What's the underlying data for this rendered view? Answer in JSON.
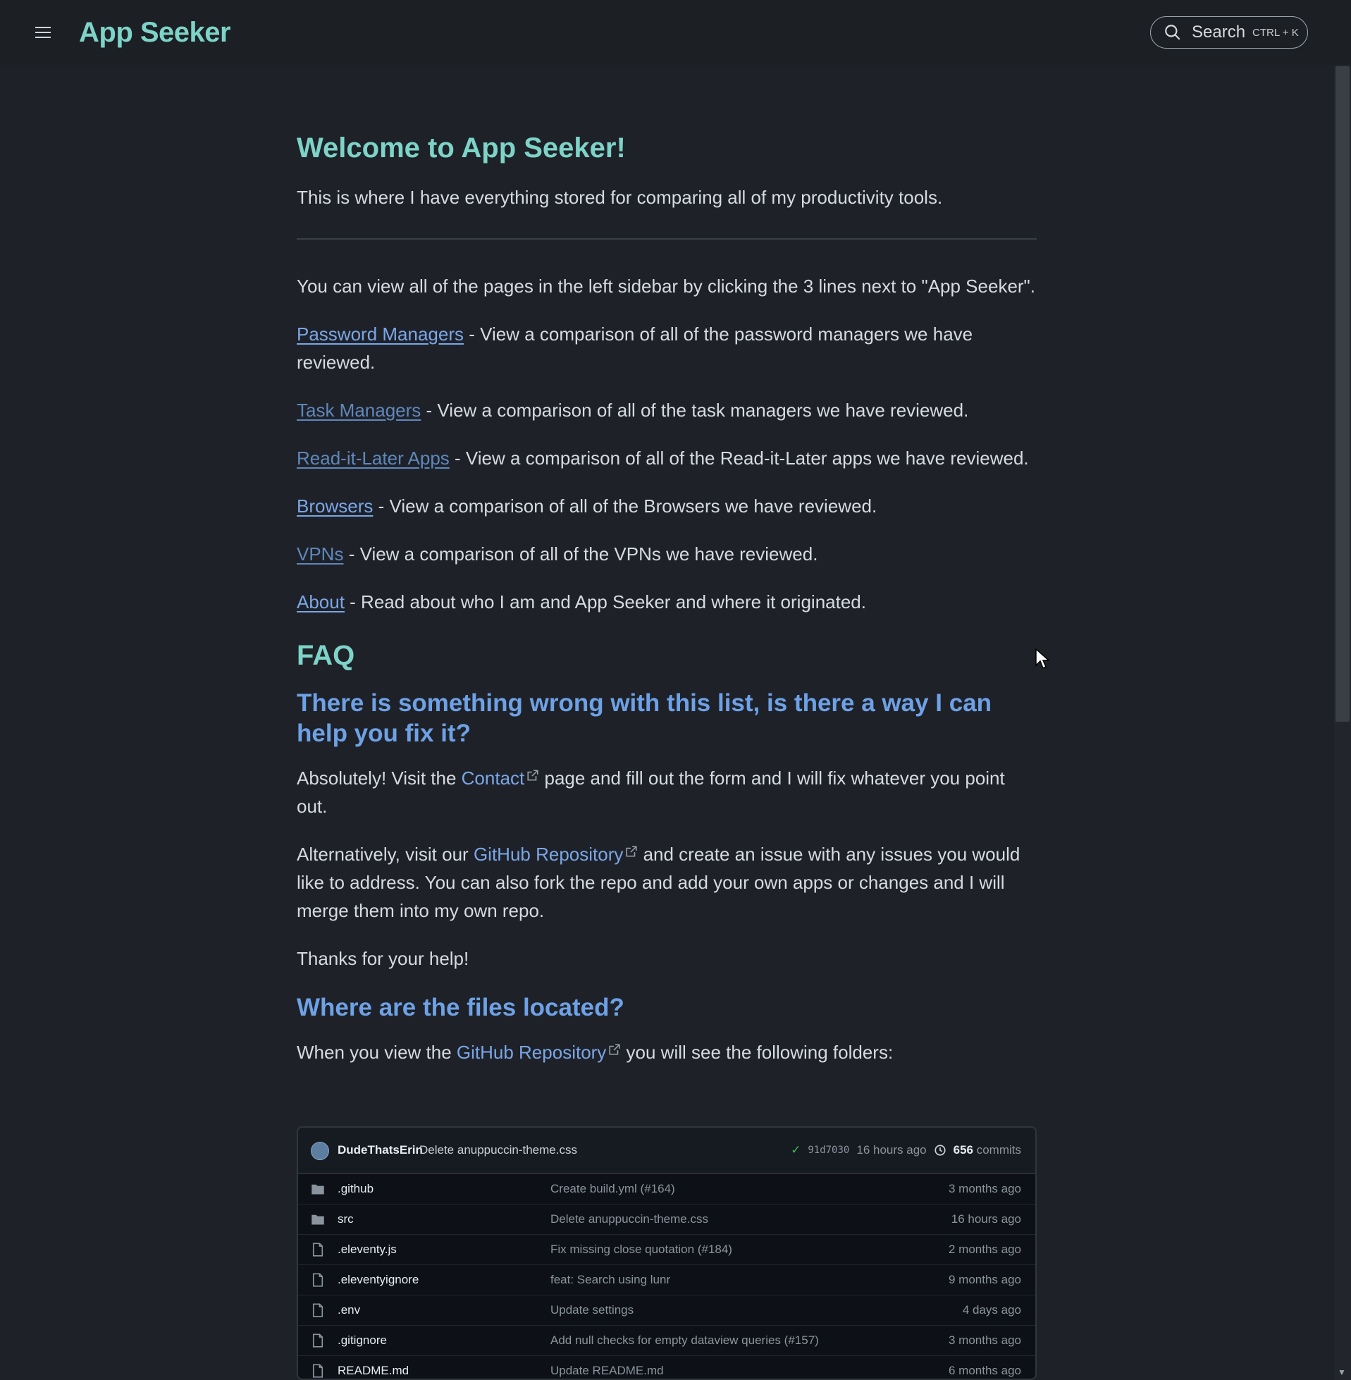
{
  "header": {
    "menu_icon": "hamburger-menu-icon",
    "site_title": "App Seeker",
    "search_label": "Search",
    "search_shortcut": "CTRL + K"
  },
  "main": {
    "title": "Welcome to App Seeker!",
    "intro": "This is where I have everything stored for comparing all of my productivity tools.",
    "sidebar_note": "You can view all of the pages in the left sidebar by clicking the 3 lines next to \"App Seeker\".",
    "links": [
      {
        "label": "Password Managers",
        "desc": " - View a comparison of all of the password managers we have reviewed."
      },
      {
        "label": "Task Managers",
        "desc": " - View a comparison of all of the task managers we have reviewed."
      },
      {
        "label": "Read-it-Later Apps",
        "desc": " - View a comparison of all of the Read-it-Later apps we have reviewed."
      },
      {
        "label": "Browsers",
        "desc": " - View a comparison of all of the Browsers we have reviewed."
      },
      {
        "label": "VPNs",
        "desc": " - View a comparison of all of the VPNs we have reviewed."
      },
      {
        "label": "About",
        "desc": " - Read about who I am and App Seeker and where it originated."
      }
    ],
    "faq_heading": "FAQ",
    "faq1": {
      "question": "There is something wrong with this list, is there a way I can help you fix it?",
      "p1_before": "Absolutely! Visit the ",
      "p1_link": "Contact",
      "p1_after": " page and fill out the form and I will fix whatever you point out.",
      "p2_before": "Alternatively, visit our ",
      "p2_link": "GitHub Repository",
      "p2_after": " and create an issue with any issues you would like to address. You can also fork the repo and add your own apps or changes and I will merge them into my own repo.",
      "p3": "Thanks for your help!"
    },
    "faq2": {
      "question": "Where are the files located?",
      "p_before": "When you view the ",
      "p_link": "GitHub Repository",
      "p_after": " you will see the following folders:"
    }
  },
  "repo": {
    "author": "DudeThatsErin",
    "commit_message": "Delete anuppuccin-theme.css",
    "commit_hash": "91d7030",
    "commit_age": "16 hours ago",
    "commit_count": "656",
    "commits_label": "commits",
    "files": [
      {
        "type": "folder",
        "name": ".github",
        "message": "Create build.yml (#164)",
        "age": "3 months ago"
      },
      {
        "type": "folder",
        "name": "src",
        "message": "Delete anuppuccin-theme.css",
        "age": "16 hours ago"
      },
      {
        "type": "file",
        "name": ".eleventy.js",
        "message": "Fix missing close quotation (#184)",
        "age": "2 months ago"
      },
      {
        "type": "file",
        "name": ".eleventyignore",
        "message": "feat: Search using lunr",
        "age": "9 months ago"
      },
      {
        "type": "file",
        "name": ".env",
        "message": "Update settings",
        "age": "4 days ago"
      },
      {
        "type": "file",
        "name": ".gitignore",
        "message": "Add null checks for empty dataview queries (#157)",
        "age": "3 months ago"
      },
      {
        "type": "file",
        "name": "README.md",
        "message": "Update README.md",
        "age": "6 months ago"
      }
    ]
  },
  "colors": {
    "background": "#1e2228",
    "accent_teal": "#7ed3c8",
    "link_blue": "#7ba6e8",
    "heading_blue": "#6ea1e6"
  }
}
